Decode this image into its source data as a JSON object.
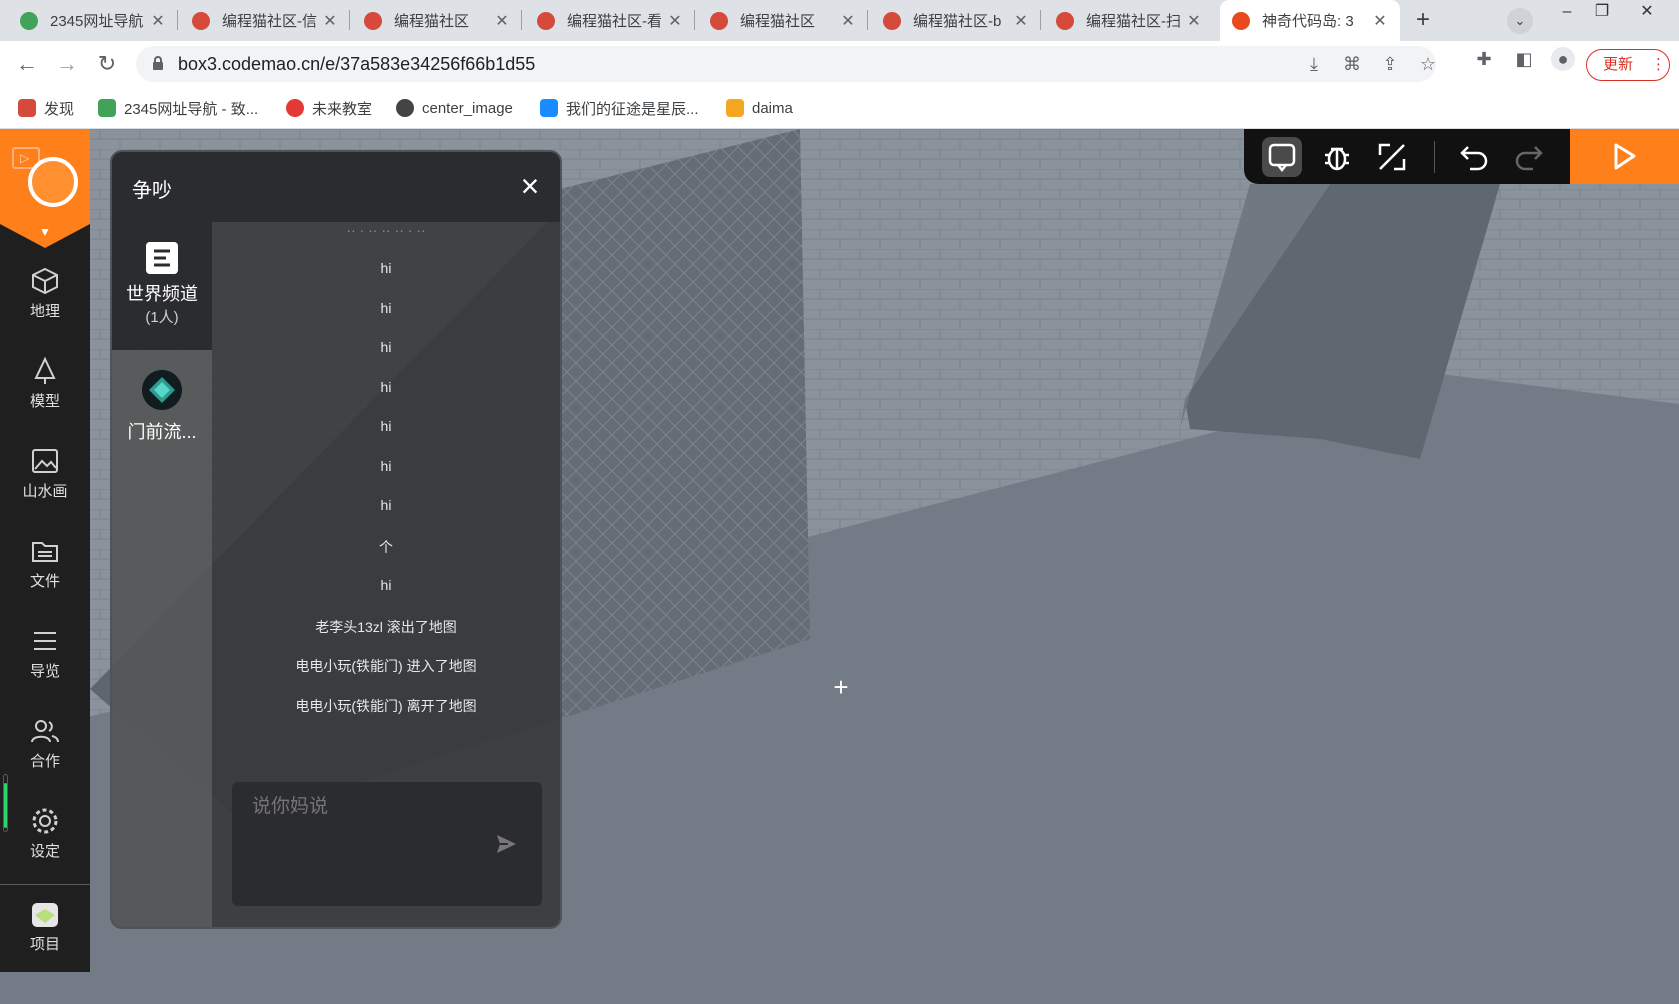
{
  "browser": {
    "tabs": [
      {
        "title": "2345网址导航",
        "favicon_color": "#41a35a"
      },
      {
        "title": "编程猫社区-信",
        "favicon_color": "#d64a3b"
      },
      {
        "title": "编程猫社区",
        "favicon_color": "#d64a3b"
      },
      {
        "title": "编程猫社区-看",
        "favicon_color": "#d64a3b"
      },
      {
        "title": "编程猫社区",
        "favicon_color": "#d64a3b"
      },
      {
        "title": "编程猫社区-b",
        "favicon_color": "#d64a3b"
      },
      {
        "title": "编程猫社区-扫",
        "favicon_color": "#d64a3b"
      },
      {
        "title": "神奇代码岛: 3",
        "favicon_color": "#e8491d",
        "active": true
      }
    ],
    "url": "box3.codemao.cn/e/37a583e34256f66b1d55",
    "update_label": "更新",
    "bookmarks": [
      {
        "label": "发现",
        "icon_color": "#d64a3b"
      },
      {
        "label": "2345网址导航 - 致...",
        "icon_color": "#41a35a"
      },
      {
        "label": "未来教室",
        "icon_color": "#e53935"
      },
      {
        "label": "center_image",
        "icon_color": "#444444"
      },
      {
        "label": "我们的征途是星辰...",
        "icon_color": "#1a8cff"
      },
      {
        "label": "daima",
        "icon_color": "#f5a623"
      }
    ]
  },
  "sidebar": {
    "items": [
      {
        "label": "地理",
        "icon": "cube-icon"
      },
      {
        "label": "模型",
        "icon": "tree-icon"
      },
      {
        "label": "山水画",
        "icon": "picture-icon"
      },
      {
        "label": "文件",
        "icon": "folder-icon"
      },
      {
        "label": "导览",
        "icon": "list-icon"
      },
      {
        "label": "合作",
        "icon": "users-icon"
      },
      {
        "label": "设定",
        "icon": "gear-icon"
      },
      {
        "label": "项目",
        "icon": "project-icon"
      }
    ]
  },
  "chat": {
    "title": "争吵",
    "channels": {
      "world_label": "世界频道",
      "world_count": "(1人)",
      "user_label": "门前流..."
    },
    "messages": [
      "hi",
      "hi",
      "hi",
      "hi",
      "hi",
      "hi",
      "hi",
      "个",
      "hi",
      "老李头13zl 滚出了地图",
      "电电小玩(铁能门) 进入了地图",
      "电电小玩(铁能门) 离开了地图"
    ],
    "input_placeholder": "说你妈说"
  },
  "colors": {
    "accent": "#ff7f1a",
    "nav_bg": "#1f1f1f",
    "scene_floor": "#737c86"
  }
}
